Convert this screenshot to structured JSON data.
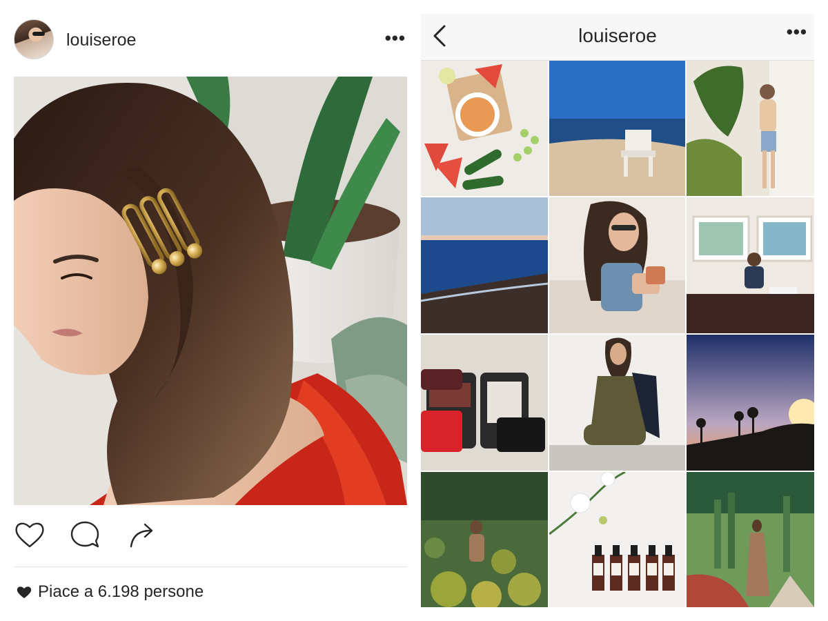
{
  "post": {
    "username": "louiseroe",
    "more": "•••",
    "likes_text": "Piace a 6.198 persone",
    "icons": {
      "like": "heart-outline-icon",
      "comment": "comment-bubble-icon",
      "share": "share-arrow-icon",
      "likes": "heart-filled-icon"
    }
  },
  "profile": {
    "title": "louiseroe",
    "more": "•••",
    "back_icon": "chevron-left-icon"
  },
  "grid": {
    "rows": 4,
    "columns": 3,
    "tiles": [
      "gazpacho-watermelon-flatlay",
      "beach-adirondack-chair",
      "woman-walking-garden",
      "ocean-dusk-shoreline",
      "woman-sunglasses-sofa",
      "woman-desk-artwork",
      "packed-suitcase-flatlay",
      "woman-crouching-wall",
      "sunset-palm-silhouettes",
      "woman-cactus-garden",
      "serum-bottles-flowers",
      "woman-cactus-path"
    ]
  },
  "colors": {
    "text": "#262626",
    "nav_bg": "#f7f7f7",
    "divider": "#e3e3e3",
    "dress_red": "#c9261a"
  }
}
